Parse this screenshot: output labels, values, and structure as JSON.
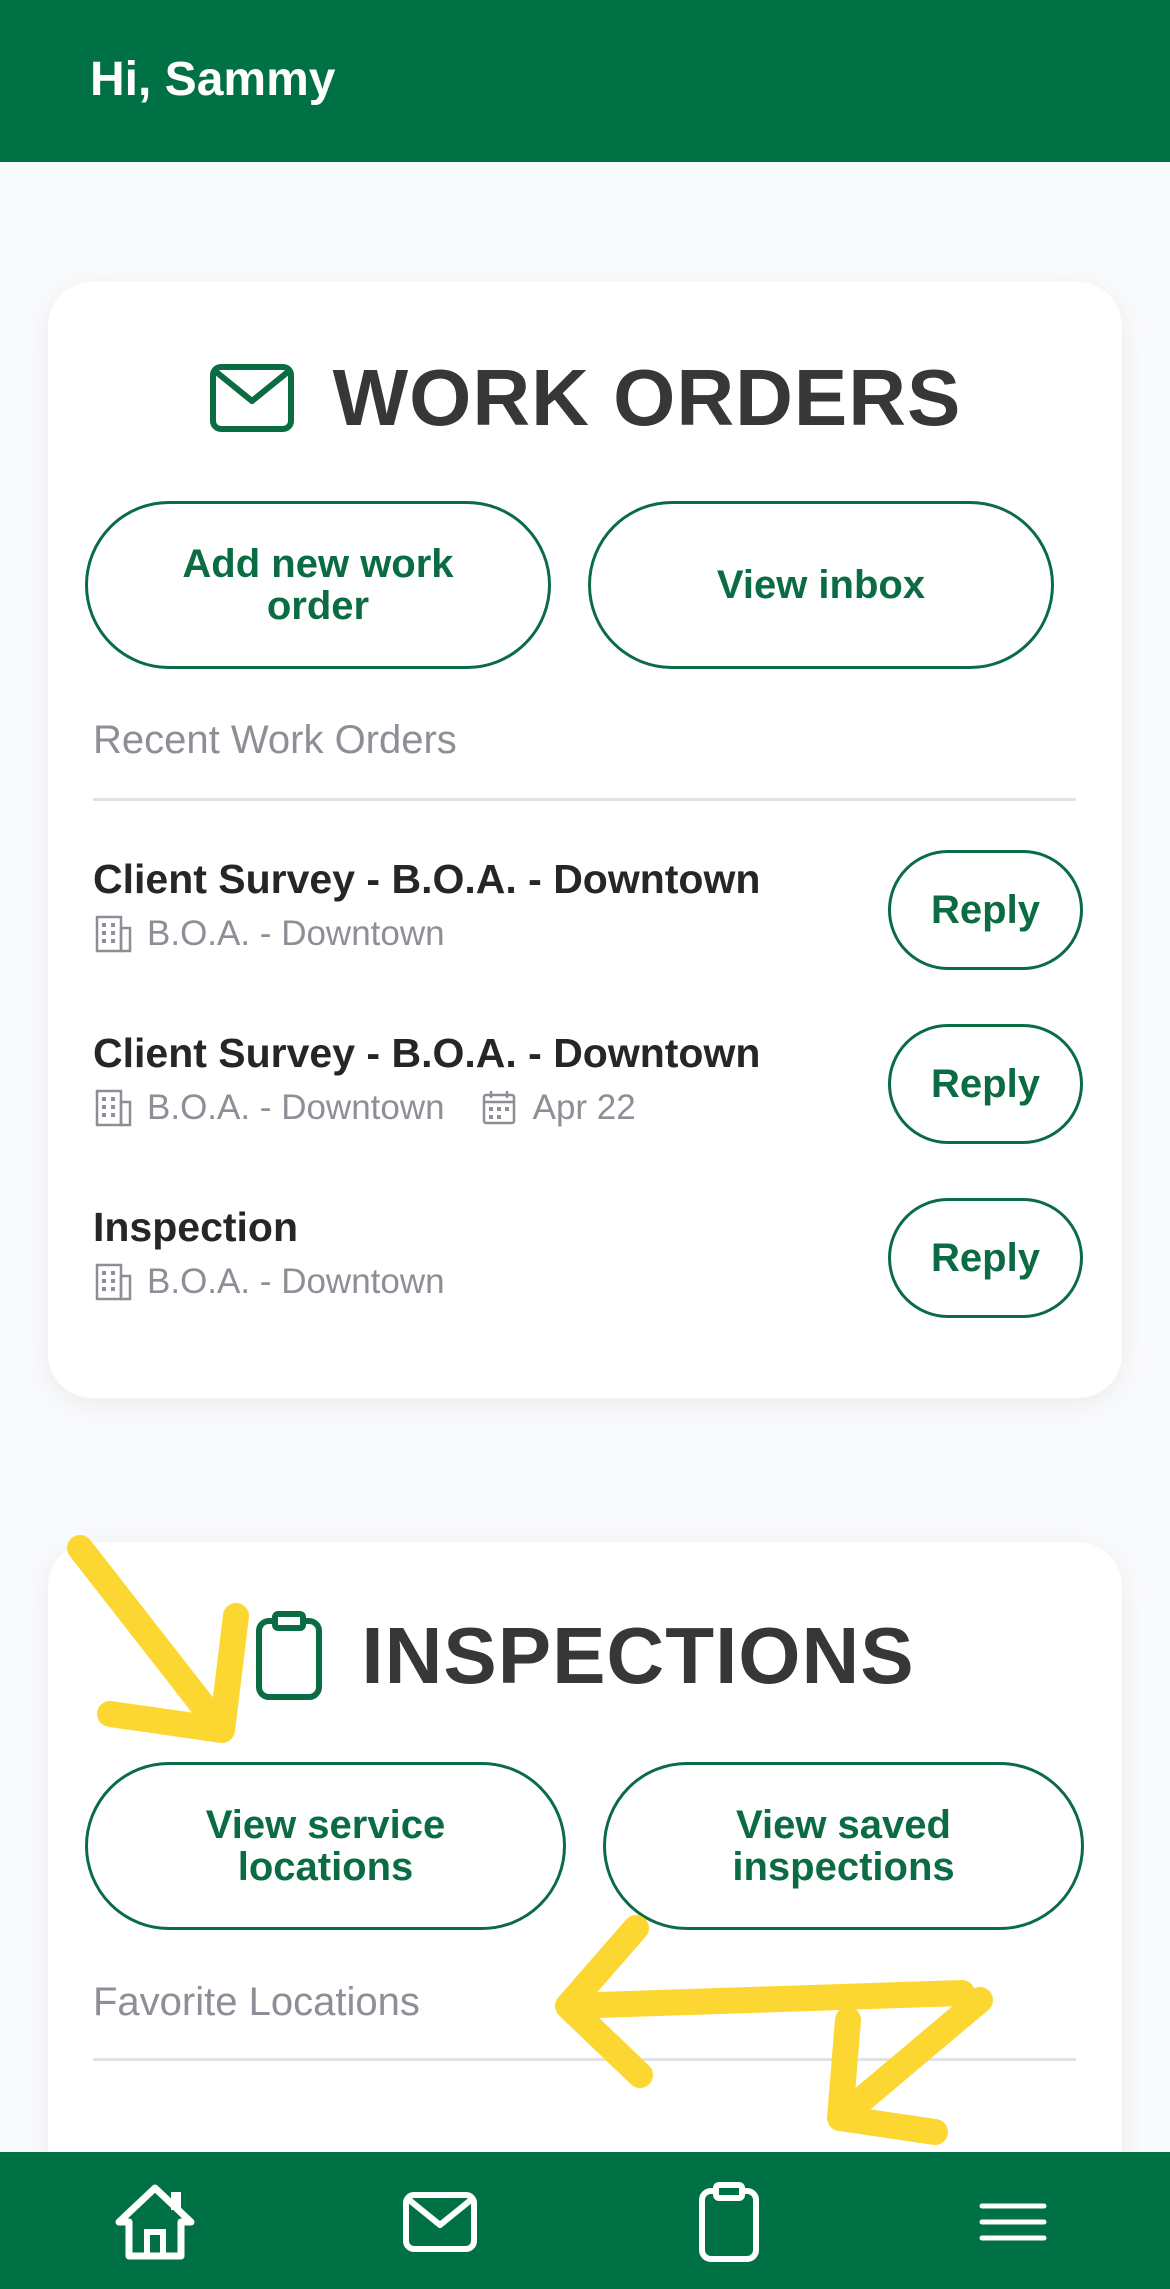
{
  "header": {
    "greeting": "Hi, Sammy"
  },
  "work_orders": {
    "title": "WORK ORDERS",
    "icon": "envelope-icon",
    "add_button": "Add new work order",
    "inbox_button": "View inbox",
    "recent_label": "Recent Work Orders",
    "items": [
      {
        "title": "Client Survey - B.O.A. - Downtown",
        "location": "B.O.A. - Downtown",
        "date": "",
        "reply": "Reply"
      },
      {
        "title": "Client Survey - B.O.A. - Downtown",
        "location": "B.O.A. - Downtown",
        "date": "Apr 22",
        "reply": "Reply"
      },
      {
        "title": "Inspection",
        "location": "B.O.A. - Downtown",
        "date": "",
        "reply": "Reply"
      }
    ]
  },
  "inspections": {
    "title": "INSPECTIONS",
    "icon": "clipboard-icon",
    "service_button": "View service locations",
    "saved_button": "View saved inspections",
    "favorites_label": "Favorite Locations"
  },
  "nav": {
    "items": [
      {
        "name": "home",
        "icon": "home-icon"
      },
      {
        "name": "work-orders",
        "icon": "envelope-icon"
      },
      {
        "name": "inspections",
        "icon": "clipboard-icon"
      },
      {
        "name": "menu",
        "icon": "hamburger-menu-icon"
      }
    ]
  },
  "colors": {
    "brand_green": "#007144",
    "annotation_yellow": "#fcd731",
    "background": "#f9fafc"
  }
}
